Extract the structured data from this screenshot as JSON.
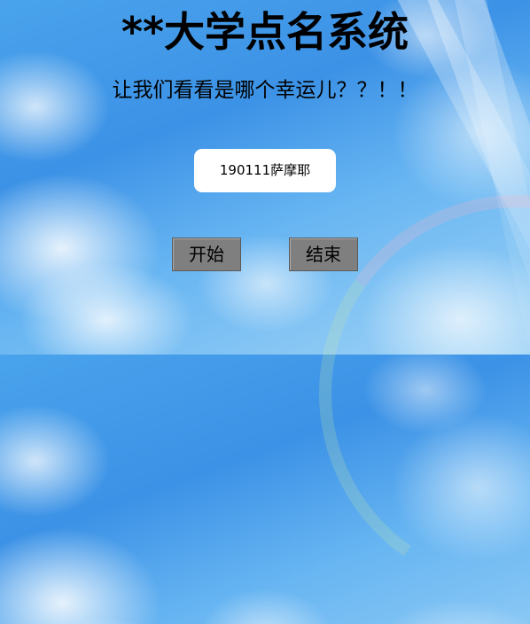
{
  "page": {
    "title": "**大学点名系统",
    "subtitle": "让我们看看是哪个幸运儿？？！！",
    "current_name": "190111萨摩耶"
  },
  "controls": {
    "start_label": "开始",
    "end_label": "结束"
  },
  "colors": {
    "button_bg": "#7f7f7f",
    "name_box_bg": "#ffffff",
    "text": "#000000"
  }
}
